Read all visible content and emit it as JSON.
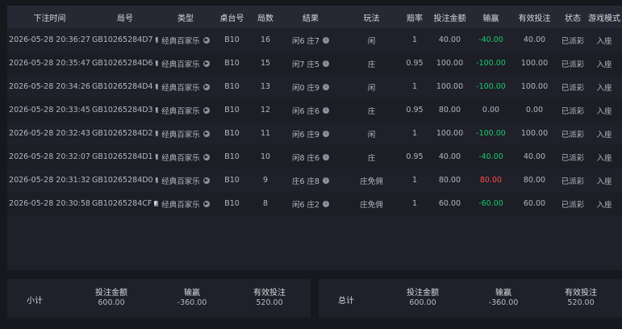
{
  "table": {
    "headers": [
      "下注时间",
      "局号",
      "类型",
      "桌台号",
      "局数",
      "结果",
      "玩法",
      "赔率",
      "投注金额",
      "输赢",
      "有效投注",
      "状态",
      "游戏模式"
    ],
    "rows": [
      {
        "time": "2026-05-28 20:36:27",
        "round_id": "GB10265284D7",
        "type": "经典百家乐",
        "table": "B10",
        "round_no": "16",
        "result": "闲6 庄7",
        "play": "闲",
        "odds": "1",
        "bet": "40.00",
        "win_loss": "-40.00",
        "win_loss_tone": "green",
        "valid_bet": "40.00",
        "status": "已派彩",
        "mode": "入座"
      },
      {
        "time": "2026-05-28 20:35:47",
        "round_id": "GB10265284D6",
        "type": "经典百家乐",
        "table": "B10",
        "round_no": "15",
        "result": "闲7 庄5",
        "play": "庄",
        "odds": "0.95",
        "bet": "100.00",
        "win_loss": "-100.00",
        "win_loss_tone": "green",
        "valid_bet": "100.00",
        "status": "已派彩",
        "mode": "入座"
      },
      {
        "time": "2026-05-28 20:34:26",
        "round_id": "GB10265284D4",
        "type": "经典百家乐",
        "table": "B10",
        "round_no": "13",
        "result": "闲0 庄9",
        "play": "闲",
        "odds": "1",
        "bet": "100.00",
        "win_loss": "-100.00",
        "win_loss_tone": "green",
        "valid_bet": "100.00",
        "status": "已派彩",
        "mode": "入座"
      },
      {
        "time": "2026-05-28 20:33:45",
        "round_id": "GB10265284D3",
        "type": "经典百家乐",
        "table": "B10",
        "round_no": "12",
        "result": "闲6 庄6",
        "play": "庄",
        "odds": "0.95",
        "bet": "80.00",
        "win_loss": "0.00",
        "win_loss_tone": "neutral",
        "valid_bet": "0.00",
        "status": "已派彩",
        "mode": "入座"
      },
      {
        "time": "2026-05-28 20:32:43",
        "round_id": "GB10265284D2",
        "type": "经典百家乐",
        "table": "B10",
        "round_no": "11",
        "result": "闲6 庄9",
        "play": "闲",
        "odds": "1",
        "bet": "100.00",
        "win_loss": "-100.00",
        "win_loss_tone": "green",
        "valid_bet": "100.00",
        "status": "已派彩",
        "mode": "入座"
      },
      {
        "time": "2026-05-28 20:32:07",
        "round_id": "GB10265284D1",
        "type": "经典百家乐",
        "table": "B10",
        "round_no": "10",
        "result": "闲8 庄6",
        "play": "庄",
        "odds": "0.95",
        "bet": "40.00",
        "win_loss": "-40.00",
        "win_loss_tone": "green",
        "valid_bet": "40.00",
        "status": "已派彩",
        "mode": "入座"
      },
      {
        "time": "2026-05-28 20:31:32",
        "round_id": "GB10265284D0",
        "type": "经典百家乐",
        "table": "B10",
        "round_no": "9",
        "result": "庄6 庄8",
        "play": "庄免佣",
        "odds": "1",
        "bet": "80.00",
        "win_loss": "80.00",
        "win_loss_tone": "red",
        "valid_bet": "80.00",
        "status": "已派彩",
        "mode": "入座"
      },
      {
        "time": "2026-05-28 20:30:58",
        "round_id": "GB10265284CF",
        "type": "经典百家乐",
        "table": "B10",
        "round_no": "8",
        "result": "闲6 庄2",
        "play": "庄免佣",
        "odds": "1",
        "bet": "60.00",
        "win_loss": "-60.00",
        "win_loss_tone": "green",
        "valid_bet": "60.00",
        "status": "已派彩",
        "mode": "入座"
      }
    ]
  },
  "summary": {
    "subtotal": {
      "title": "小计",
      "bet_label": "投注金额",
      "bet_value": "600.00",
      "win_label": "输赢",
      "win_value": "-360.00",
      "valid_label": "有效投注",
      "valid_value": "520.00"
    },
    "total": {
      "title": "总计",
      "bet_label": "投注金额",
      "bet_value": "600.00",
      "win_label": "输赢",
      "win_value": "-360.00",
      "valid_label": "有效投注",
      "valid_value": "520.00"
    }
  },
  "icons": {
    "copy": "copy-icon",
    "play": "play-icon",
    "info": "info-icon"
  },
  "colors": {
    "background": "#17181d",
    "panel": "#1f2029",
    "header": "#262834",
    "green": "#19c86f",
    "red": "#ff4c4c"
  }
}
